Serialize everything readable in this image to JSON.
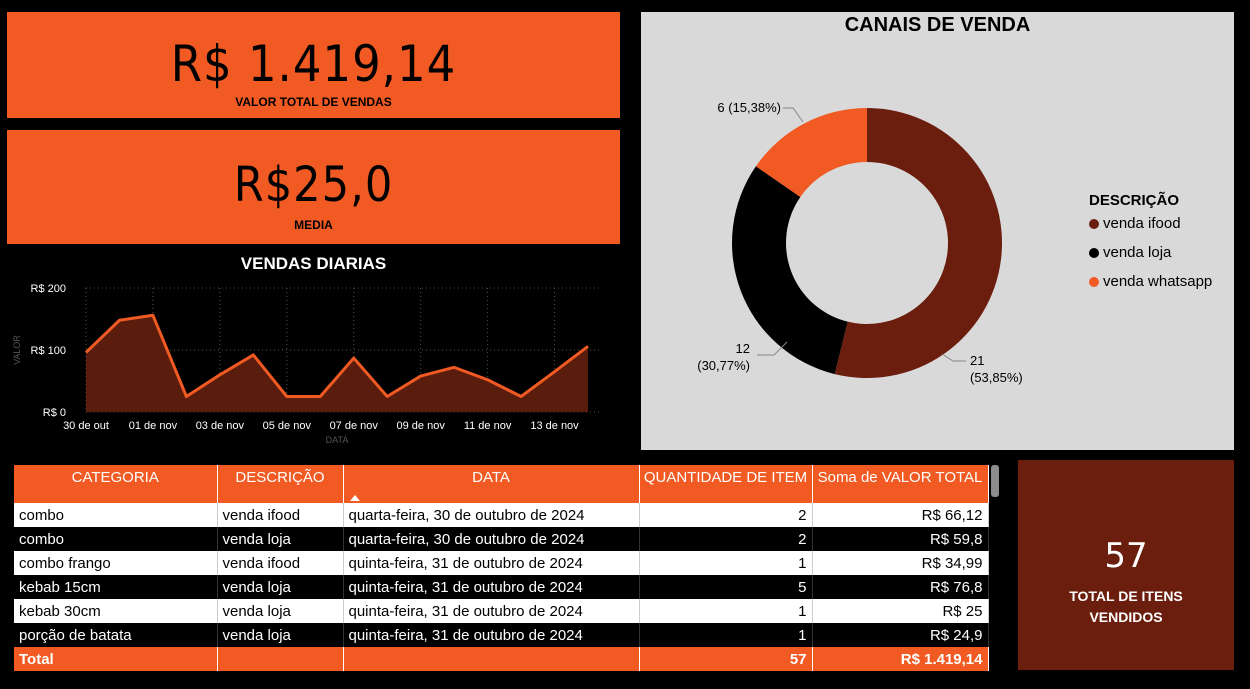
{
  "kpis": {
    "total_sales": {
      "value": "R$ 1.419,14",
      "label": "VALOR TOTAL DE VENDAS"
    },
    "average": {
      "value": "R$25,0",
      "label": "MEDIA"
    },
    "total_items": {
      "value": "57",
      "label_line1": "TOTAL DE ITENS",
      "label_line2": "VENDIDOS"
    }
  },
  "colors": {
    "accent": "#F15A22",
    "ifood": "#6B1E0E",
    "loja": "#000000",
    "whatsapp": "#F15A22",
    "panel": "#D9D9D9"
  },
  "chart_data": [
    {
      "type": "area",
      "title": "VENDAS DIARIAS",
      "xlabel": "DATA",
      "ylabel": "VALOR",
      "ylim": [
        0,
        200
      ],
      "yticks": [
        "R$ 0",
        "R$ 100",
        "R$ 200"
      ],
      "ytick_values": [
        0,
        100,
        200
      ],
      "xtick_labels": [
        "30 de out",
        "01 de nov",
        "03 de nov",
        "05 de nov",
        "07 de nov",
        "09 de nov",
        "11 de nov",
        "13 de nov"
      ],
      "xtick_index": [
        0,
        2,
        4,
        6,
        8,
        10,
        12,
        14
      ],
      "values": [
        96,
        148,
        156,
        25,
        60,
        92,
        25,
        25,
        87,
        25,
        58,
        72,
        52,
        25,
        65,
        106
      ],
      "color": "#F15A22",
      "fill": "#5A1C0C",
      "grid": true
    },
    {
      "type": "pie",
      "title": "CANAIS DE VENDA",
      "legend_title": "DESCRIÇÃO",
      "legend_position": "right",
      "categories": [
        "venda ifood",
        "venda loja",
        "venda whatsapp"
      ],
      "values": [
        21,
        12,
        6
      ],
      "percent_labels": [
        "(53,85%)",
        "(30,77%)",
        "(15,38%)"
      ],
      "colors": [
        "#6B1E0E",
        "#000000",
        "#F15A22"
      ],
      "donut": true
    }
  ],
  "table": {
    "headers": [
      "CATEGORIA",
      "DESCRIÇÃO",
      "DATA",
      "QUANTIDADE DE ITEM",
      "Soma de VALOR TOTAL"
    ],
    "rows": [
      [
        "combo",
        "venda ifood",
        "quarta-feira, 30 de outubro de 2024",
        "2",
        "R$ 66,12"
      ],
      [
        "combo",
        "venda loja",
        "quarta-feira, 30 de outubro de 2024",
        "2",
        "R$ 59,8"
      ],
      [
        "combo frango",
        "venda ifood",
        "quinta-feira, 31 de outubro de 2024",
        "1",
        "R$ 34,99"
      ],
      [
        "kebab 15cm",
        "venda loja",
        "quinta-feira, 31 de outubro de 2024",
        "5",
        "R$ 76,8"
      ],
      [
        "kebab 30cm",
        "venda loja",
        "quinta-feira, 31 de outubro de 2024",
        "1",
        "R$ 25"
      ],
      [
        "porção de batata",
        "venda loja",
        "quinta-feira, 31 de outubro de 2024",
        "1",
        "R$ 24,9"
      ]
    ],
    "total": {
      "label": "Total",
      "quantity": "57",
      "value": "R$ 1.419,14"
    }
  }
}
